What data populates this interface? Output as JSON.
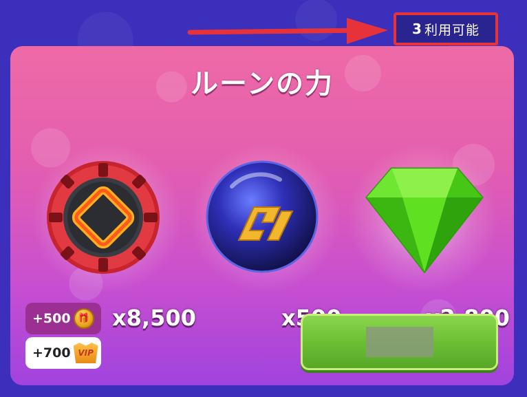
{
  "availability": {
    "count": "3",
    "label": "利用可能"
  },
  "panel": {
    "title": "ルーンの力"
  },
  "rewards": [
    {
      "name": "rune-chip",
      "quantity": "x8,500"
    },
    {
      "name": "blue-orb",
      "quantity": "x500"
    },
    {
      "name": "green-gem",
      "quantity": "x2,800"
    }
  ],
  "bonuses": {
    "coins": {
      "amount": "+500",
      "icon": "gift-coin-icon"
    },
    "vip": {
      "amount": "+700",
      "icon": "vip-crown-icon",
      "badge_text": "VIP"
    }
  },
  "buy_button": {
    "label": ""
  },
  "colors": {
    "background": "#3b2fb8",
    "panel_top": "#ee6aa6",
    "panel_bottom": "#a043de",
    "highlight_border": "#e8323a",
    "button_green": "#6cbf34"
  }
}
